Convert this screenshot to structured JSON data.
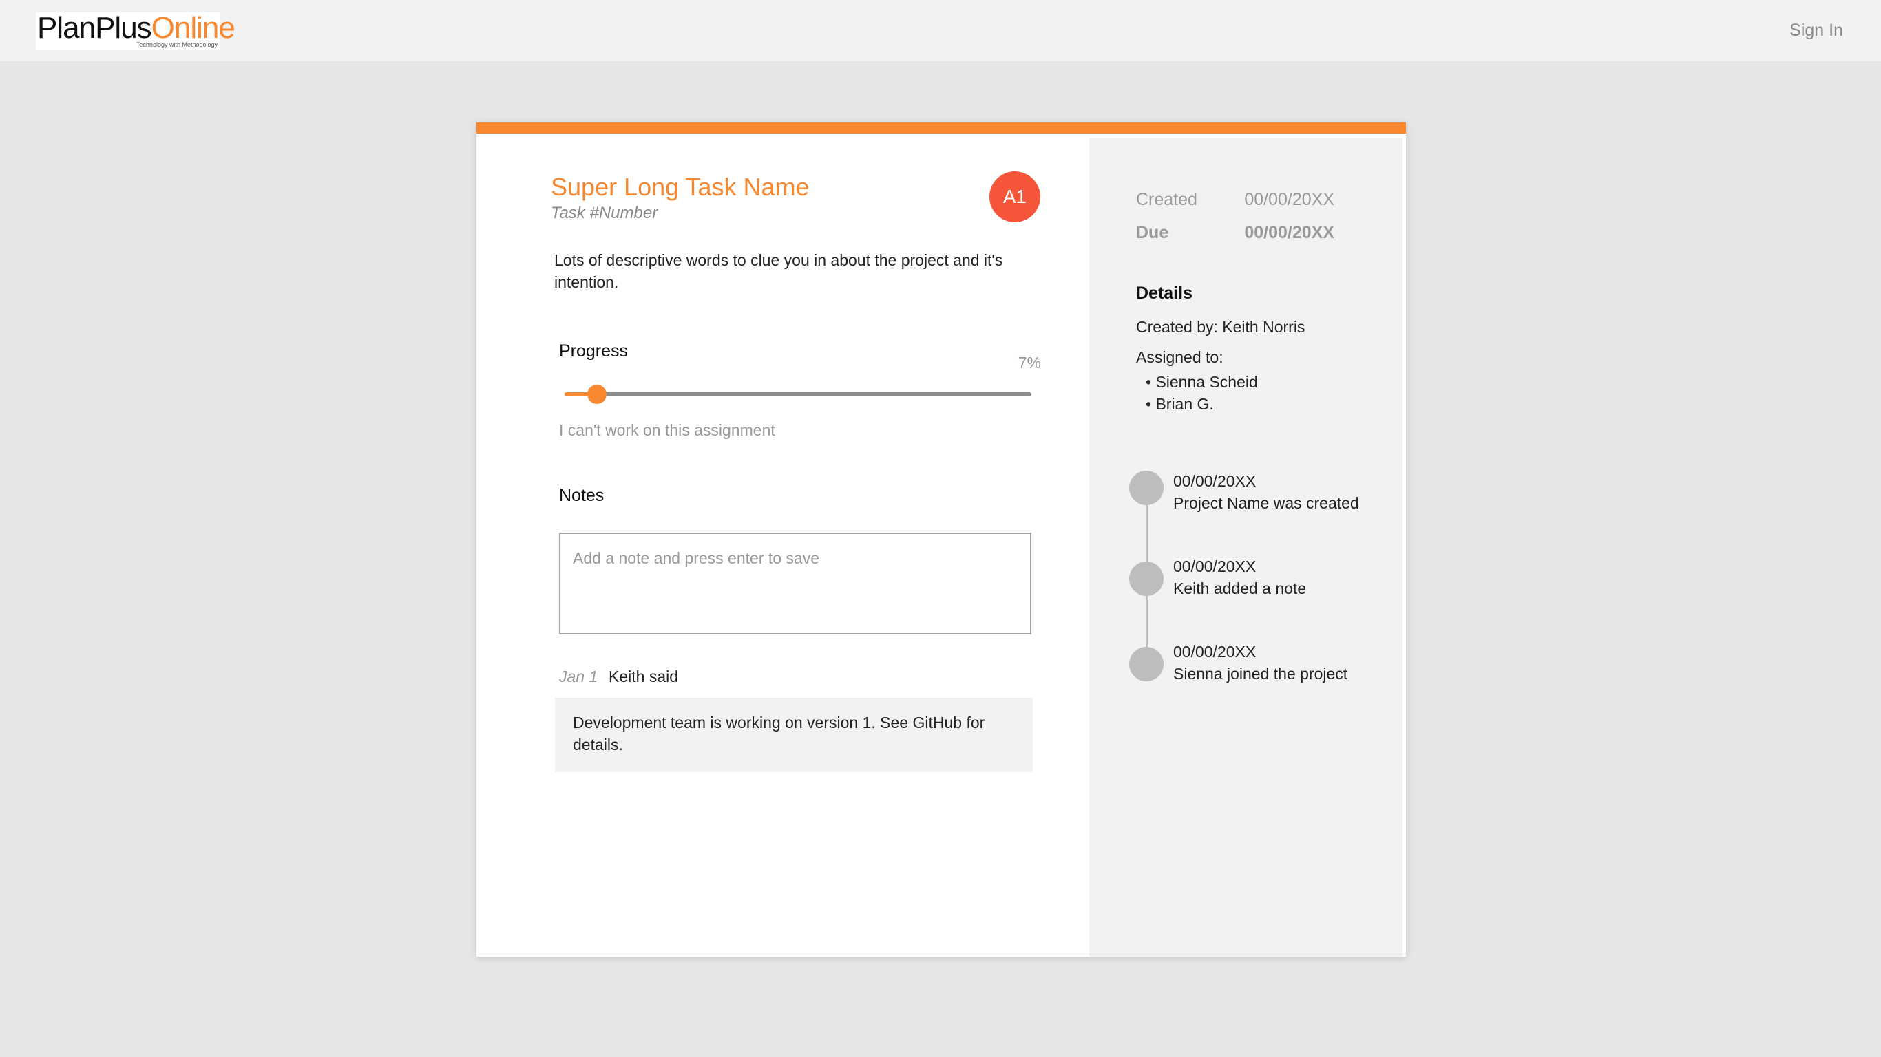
{
  "header": {
    "logo": {
      "plan": "PlanPlus",
      "online": "Online",
      "tagline": "Technology with Methodology"
    },
    "sign_in": "Sign In"
  },
  "task": {
    "title": "Super Long Task Name",
    "number": "Task #Number",
    "avatar": "A1",
    "description": "Lots of descriptive words to clue you in about the project and it's intention."
  },
  "progress": {
    "label": "Progress",
    "value_text": "7%",
    "value": 0.07,
    "cant_work": "I can't work on this assignment"
  },
  "notes": {
    "label": "Notes",
    "placeholder": "Add a note and press enter to save",
    "items": [
      {
        "date": "Jan 1",
        "author": "Keith said",
        "text": "Development team is working on version 1. See GitHub for details."
      }
    ]
  },
  "meta": {
    "created_label": "Created",
    "created_value": "00/00/20XX",
    "due_label": "Due",
    "due_value": "00/00/20XX"
  },
  "details": {
    "title": "Details",
    "created_by": "Created by: Keith Norris",
    "assigned_to": "Assigned to:",
    "assignees": [
      "• Sienna Scheid",
      "• Brian G."
    ]
  },
  "timeline": [
    {
      "date": "00/00/20XX",
      "text": "Project Name was created"
    },
    {
      "date": "00/00/20XX",
      "text": "Keith added a note"
    },
    {
      "date": "00/00/20XX",
      "text": "Sienna joined the project"
    }
  ],
  "colors": {
    "accent": "#f7882f",
    "avatar": "#f5563a",
    "panel": "#f2f2f2",
    "timeline": "#bdbdbd"
  }
}
